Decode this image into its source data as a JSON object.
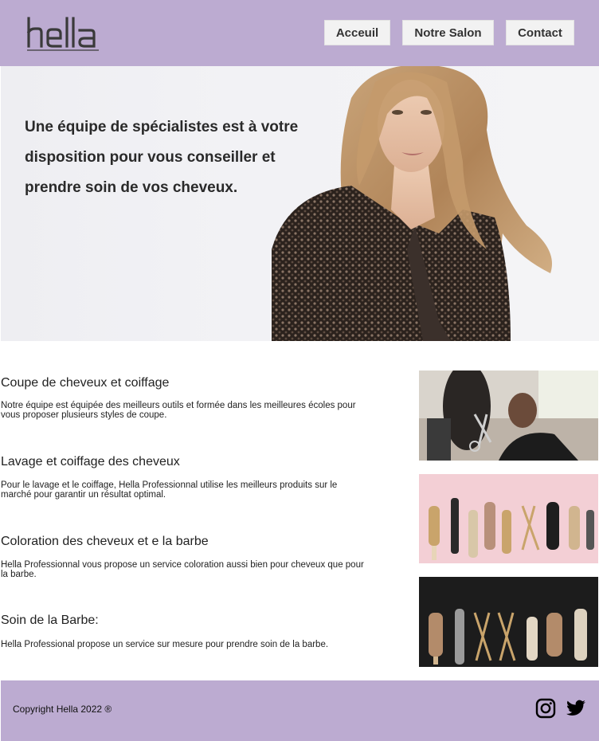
{
  "brand": {
    "logo_text": "hella"
  },
  "nav": {
    "accueil": "Acceuil",
    "salon": "Notre Salon",
    "contact": "Contact"
  },
  "hero": {
    "headline": "Une équipe de spécialistes est à votre disposition pour vous conseiller et prendre soin de vos cheveux."
  },
  "services": [
    {
      "title": "Coupe de cheveux et coiffage",
      "description": "Notre équipe est équipée des meilleurs outils et formée dans les meilleures écoles pour vous proposer plusieurs styles de coupe."
    },
    {
      "title": "Lavage et coiffage des cheveux",
      "description": "Pour le lavage et le coiffage, Hella Professionnal utilise les meilleurs produits sur le marché pour garantir un résultat optimal."
    },
    {
      "title": "Coloration des cheveux et e la barbe",
      "description": "Hella Professionnal vous propose un service coloration aussi bien pour cheveux que pour la barbe."
    },
    {
      "title": "Soin de la Barbe:",
      "description": "Hella Professional propose un service sur mesure pour prendre soin de la barbe."
    }
  ],
  "footer": {
    "copyright": "Copyright Hella 2022 ®"
  },
  "icons": {
    "instagram": "instagram-icon",
    "twitter": "twitter-icon"
  },
  "colors": {
    "brand_lavender": "#bcabd1",
    "nav_button_bg": "#f2f2f2"
  }
}
